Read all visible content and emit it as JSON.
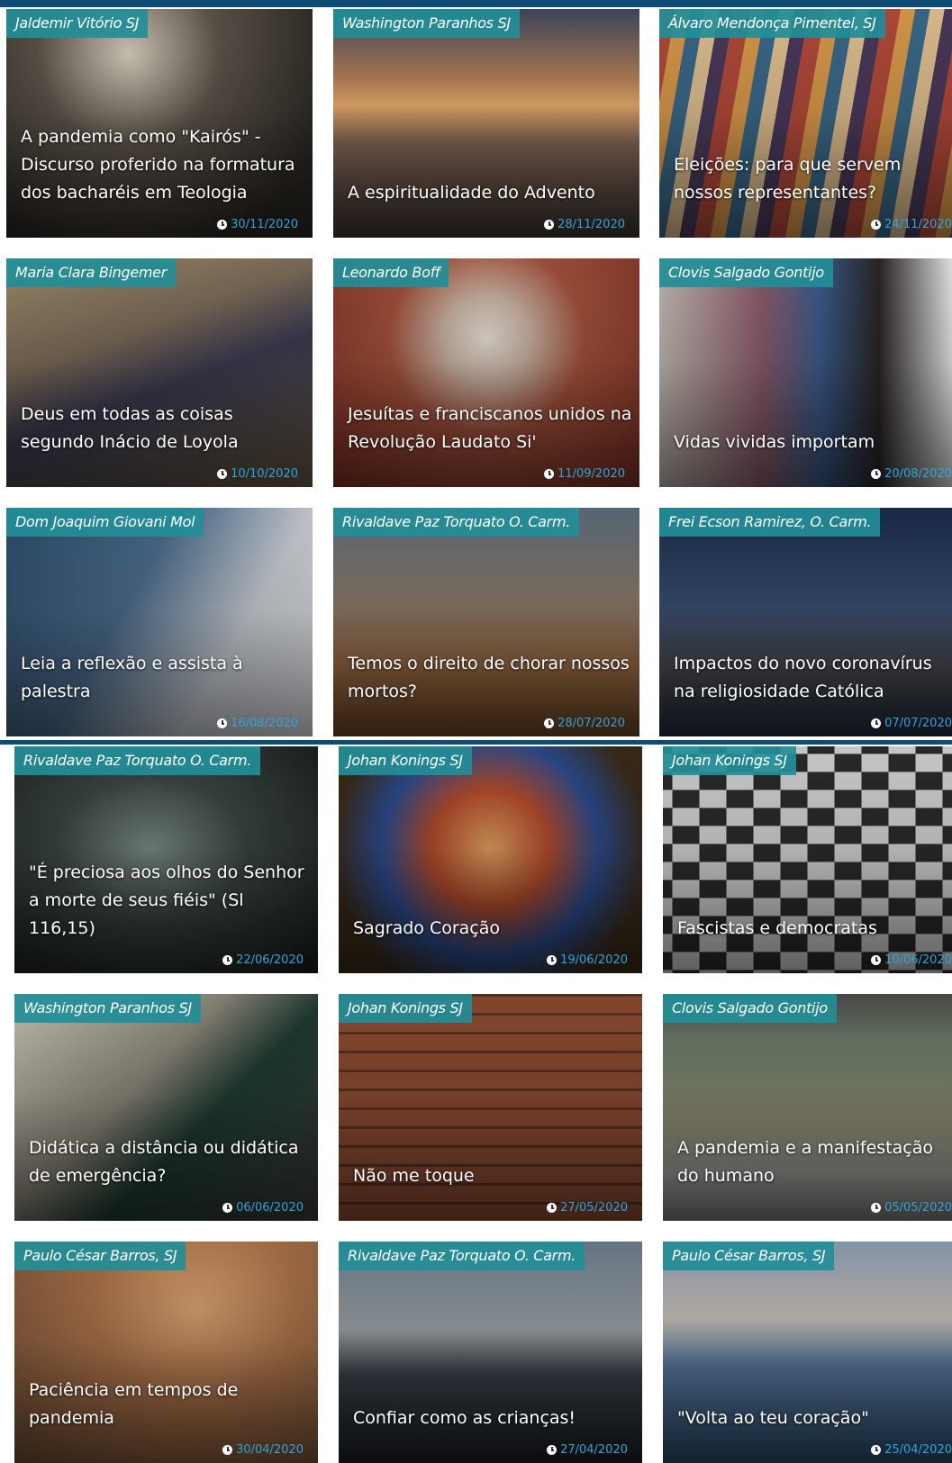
{
  "cards": [
    {
      "author": "Jaldemir Vitório SJ",
      "title": "A pandemia como \"Kairós\" - Discurso proferido na formatura dos bacharéis em Teologia",
      "date": "30/11/2020",
      "bg": "#3b3630"
    },
    {
      "author": "Washington Paranhos SJ",
      "title": "A espiritualidade do Advento",
      "date": "28/11/2020",
      "bg": "#6a4a37"
    },
    {
      "author": "Álvaro Mendonça Pimentel, SJ",
      "title": "Eleições: para que servem nossos representantes?",
      "date": "24/11/2020",
      "bg": "#8a5245"
    },
    {
      "author": "Maria Clara Bingemer",
      "title": "Deus em todas as coisas segundo Inácio de Loyola",
      "date": "10/10/2020",
      "bg": "#6c5a4a"
    },
    {
      "author": "Leonardo Boff",
      "title": "Jesuítas e franciscanos unidos na Revolução Laudato Si'",
      "date": "11/09/2020",
      "bg": "#8a4d3d"
    },
    {
      "author": "Clovis Salgado Gontijo",
      "title": "Vidas vividas importam",
      "date": "20/08/2020",
      "bg": "#5c5456"
    },
    {
      "author": "Dom Joaquim Giovani Mol",
      "title": "Leia a reflexão e assista à palestra",
      "date": "16/08/2020",
      "bg": "#7c8794"
    },
    {
      "author": "Rivaldave Paz Torquato O. Carm.",
      "title": "Temos o direito de chorar nossos mortos?",
      "date": "28/07/2020",
      "bg": "#6a4e36"
    },
    {
      "author": "Frei Ecson Ramirez, O. Carm.",
      "title": "Impactos do novo coronavírus na religiosidade Católica",
      "date": "07/07/2020",
      "bg": "#2b3d57"
    },
    {
      "author": "Rivaldave Paz Torquato O. Carm.",
      "title": "\"É preciosa aos olhos do Senhor a morte de seus fiéis\" (Sl 116,15)",
      "date": "22/06/2020",
      "bg": "#2d3430"
    },
    {
      "author": "Johan Konings SJ",
      "title": "Sagrado Coração",
      "date": "19/06/2020",
      "bg": "#6b4322"
    },
    {
      "author": "Johan Konings SJ",
      "title": "Fascistas e democratas",
      "date": "10/06/2020",
      "bg": "#646464"
    },
    {
      "author": "Washington Paranhos SJ",
      "title": "Didática a distância ou didática de emergência?",
      "date": "06/06/2020",
      "bg": "#4f5250"
    },
    {
      "author": "Johan Konings SJ",
      "title": "Não me toque",
      "date": "27/05/2020",
      "bg": "#6b4533"
    },
    {
      "author": "Clovis Salgado Gontijo",
      "title": "A pandemia e a manifestação do humano",
      "date": "05/05/2020",
      "bg": "#5f5f5c"
    },
    {
      "author": "Paulo César Barros, SJ",
      "title": "Paciência em tempos de pandemia",
      "date": "30/04/2020",
      "bg": "#8a6548"
    },
    {
      "author": "Rivaldave Paz Torquato O. Carm.",
      "title": "Confiar como as crianças!",
      "date": "27/04/2020",
      "bg": "#3a4148"
    },
    {
      "author": "Paulo César Barros, SJ",
      "title": "\"Volta ao teu coração\"",
      "date": "25/04/2020",
      "bg": "#4a6a8a"
    }
  ]
}
